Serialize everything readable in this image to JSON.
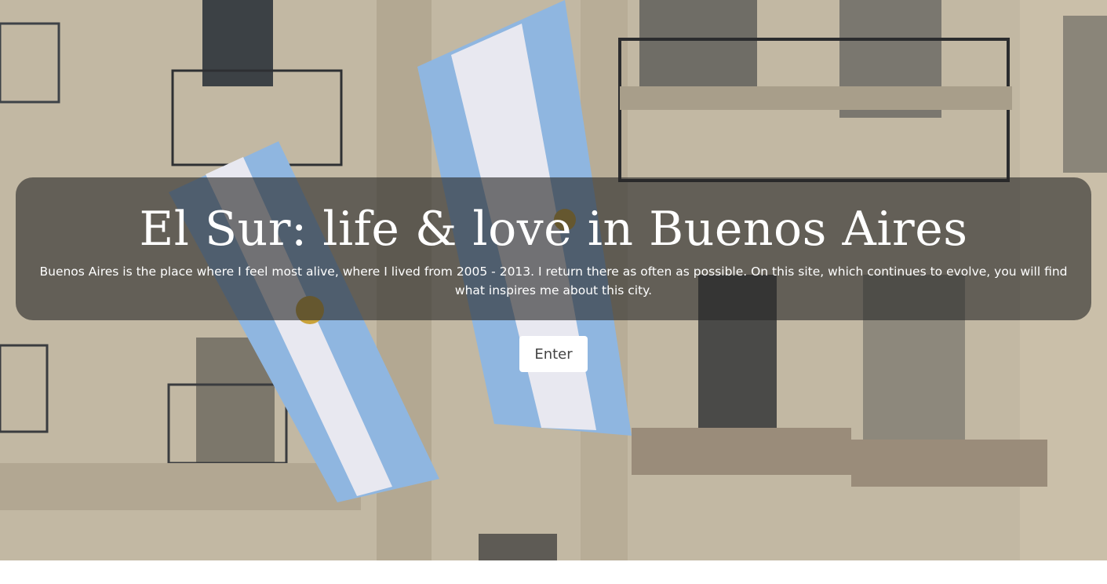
{
  "hero": {
    "title": "El Sur: life & love in Buenos Aires",
    "intro": "Buenos Aires is the place where I feel most alive, where I lived from 2005 - 2013. I return there as often as possible. On this site, which continues to evolve, you will find what inspires me about this city.",
    "enter_label": "Enter",
    "background_description": "photo of ornate Buenos Aires building facade with balconies and Argentine flags"
  },
  "colors": {
    "overlay": "#282828",
    "flag_blue": "#8fb6e0",
    "flag_white": "#e8e8f0",
    "sun": "#c9a23a",
    "button_bg": "#ffffff",
    "button_text": "#444444"
  }
}
